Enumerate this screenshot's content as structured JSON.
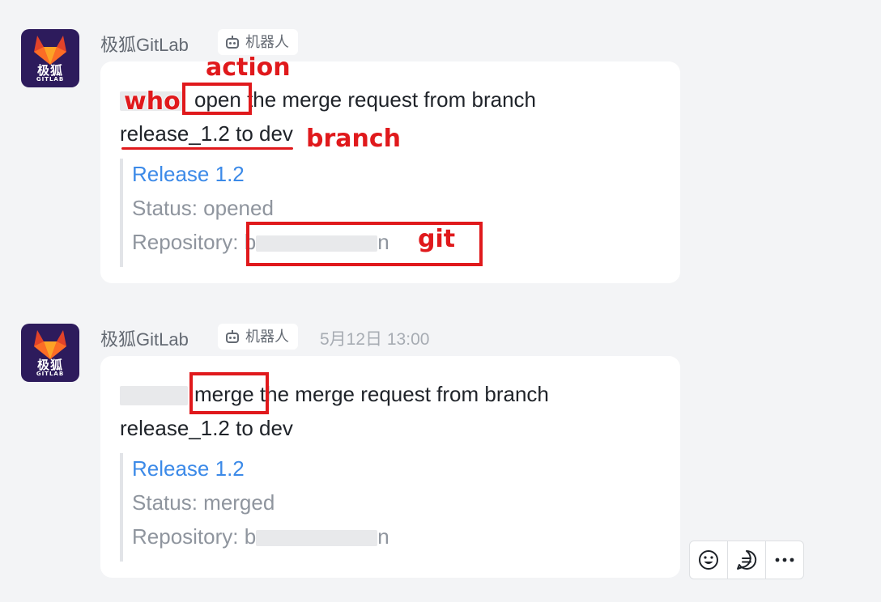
{
  "messages": [
    {
      "avatar": {
        "text": "极狐",
        "sub": "GITLAB"
      },
      "sender": "极狐GitLab",
      "bot_label": "机器人",
      "time": "",
      "text_action": "open",
      "text_rest": " the merge request from branch",
      "text_line2": "release_1.2 to dev",
      "quote": {
        "title": "Release 1.2",
        "status": "Status: opened",
        "repo_prefix": "Repository: b",
        "repo_suffix": "n"
      },
      "annotations": {
        "who": "who",
        "action": "action",
        "branch": "branch",
        "git": "git"
      }
    },
    {
      "avatar": {
        "text": "极狐",
        "sub": "GITLAB"
      },
      "sender": "极狐GitLab",
      "bot_label": "机器人",
      "time": "5月12日 13:00",
      "text_action": "merge",
      "text_rest": " the merge request from branch",
      "text_line2": "release_1.2 to dev",
      "quote": {
        "title": "Release 1.2",
        "status": "Status: merged",
        "repo_prefix": "Repository: b",
        "repo_suffix": "n"
      }
    }
  ],
  "colors": {
    "accent_link": "#3c8ae8",
    "annotation": "#e0191c",
    "background": "#f3f4f6"
  },
  "actions": [
    "emoji-icon",
    "reply-icon",
    "more-icon"
  ]
}
